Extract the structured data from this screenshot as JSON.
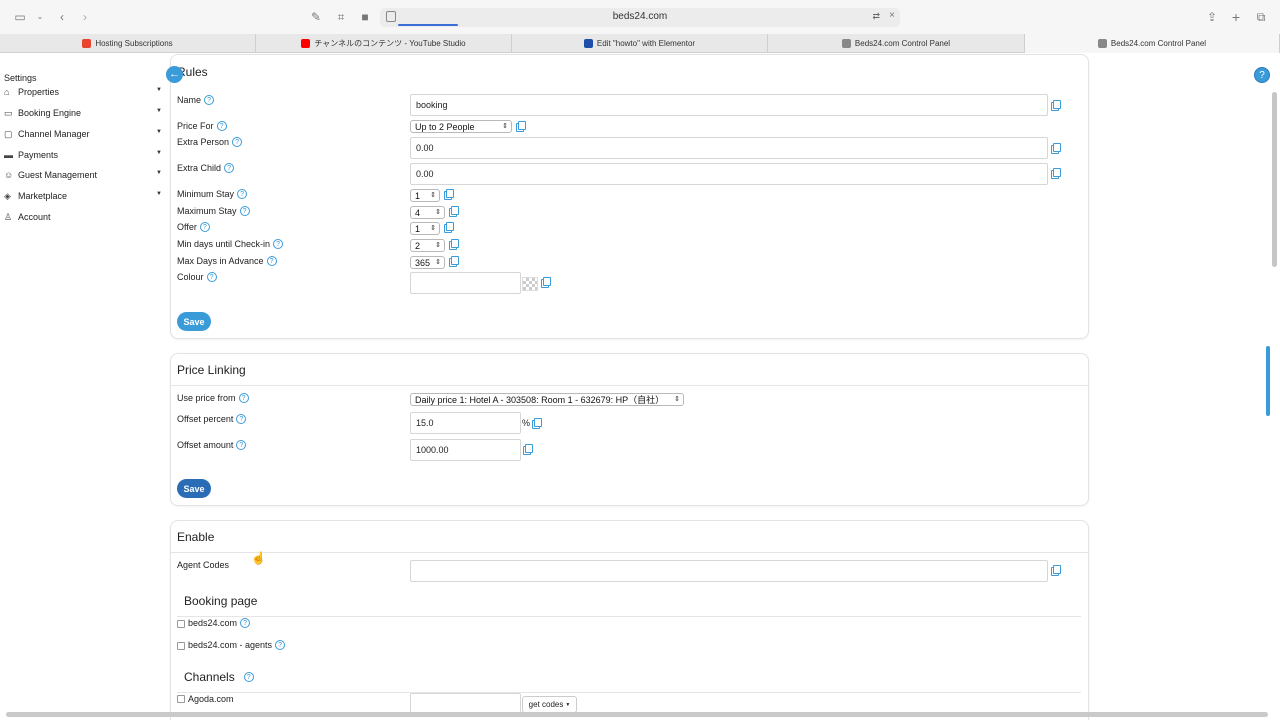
{
  "browser": {
    "url": "beds24.com",
    "tabs": [
      {
        "label": "Hosting Subscriptions",
        "favicon_color": "#e8442e"
      },
      {
        "label": "チャンネルのコンテンツ - YouTube Studio",
        "favicon_color": "#ff0000"
      },
      {
        "label": "Edit \"howto\" with Elementor",
        "favicon_color": "#1e4fa8"
      },
      {
        "label": "Beds24.com Control Panel",
        "favicon_color": "#555555"
      },
      {
        "label": "Beds24.com Control Panel",
        "favicon_color": "#555555"
      }
    ]
  },
  "sidebar": {
    "title": "Settings",
    "items": [
      {
        "label": "Properties",
        "icon": "home-icon"
      },
      {
        "label": "Booking Engine",
        "icon": "monitor-icon"
      },
      {
        "label": "Channel Manager",
        "icon": "chat-icon"
      },
      {
        "label": "Payments",
        "icon": "card-icon"
      },
      {
        "label": "Guest Management",
        "icon": "people-icon"
      },
      {
        "label": "Marketplace",
        "icon": "tag-icon"
      },
      {
        "label": "Account",
        "icon": "user-icon"
      }
    ]
  },
  "rules": {
    "title": "Rules",
    "name_label": "Name",
    "name_value": "booking",
    "price_for_label": "Price For",
    "price_for_value": "Up to 2 People",
    "extra_person_label": "Extra Person",
    "extra_person_value": "0.00",
    "extra_child_label": "Extra Child",
    "extra_child_value": "0.00",
    "min_stay_label": "Minimum Stay",
    "min_stay_value": "1",
    "max_stay_label": "Maximum Stay",
    "max_stay_value": "4",
    "offer_label": "Offer",
    "offer_value": "1",
    "min_days_label": "Min days until Check-in",
    "min_days_value": "2",
    "max_days_label": "Max Days in Advance",
    "max_days_value": "365",
    "colour_label": "Colour",
    "colour_value": "",
    "save_label": "Save"
  },
  "price_linking": {
    "title": "Price Linking",
    "use_price_label": "Use price from",
    "use_price_value": "Daily price 1: Hotel A - 303508: Room 1 - 632679: HP（自社）",
    "offset_percent_label": "Offset percent",
    "offset_percent_value": "15.0",
    "percent_suffix": "%",
    "offset_amount_label": "Offset amount",
    "offset_amount_value": "1000.00",
    "save_label": "Save"
  },
  "enable": {
    "title": "Enable",
    "agent_codes_label": "Agent Codes",
    "agent_codes_value": "",
    "booking_page_title": "Booking page",
    "booking_page_options": [
      {
        "label": "beds24.com",
        "checked": false
      },
      {
        "label": "beds24.com - agents",
        "checked": false
      }
    ],
    "channels_title": "Channels",
    "channels": [
      {
        "label": "Agoda.com",
        "checked": false
      }
    ],
    "get_codes_label": "get codes"
  },
  "help_symbol": "?",
  "colors": {
    "accent": "#3a9bd9",
    "save_dark": "#2a6cb6"
  }
}
